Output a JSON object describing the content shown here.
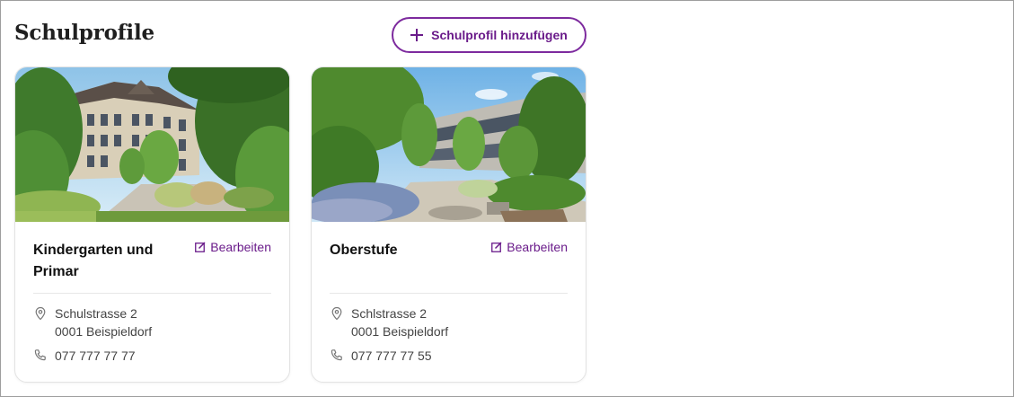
{
  "page": {
    "title": "Schulprofile",
    "add_button_label": "Schulprofil hinzufügen"
  },
  "colors": {
    "accent": "#6a1b8a",
    "text": "#1a1a1a",
    "muted": "#444444"
  },
  "cards": [
    {
      "title": "Kindergarten und Primar",
      "edit_label": "Bearbeiten",
      "address_line1": "Schulstrasse 2",
      "address_line2": "0001 Beispieldorf",
      "phone": "077 777 77 77"
    },
    {
      "title": "Oberstufe",
      "edit_label": "Bearbeiten",
      "address_line1": "Schlstrasse 2",
      "address_line2": "0001 Beispieldorf",
      "phone": "077 777 77 55"
    }
  ],
  "icons": {
    "add": "plus-icon",
    "edit": "edit-icon",
    "address": "map-pin-icon",
    "phone": "phone-icon"
  }
}
